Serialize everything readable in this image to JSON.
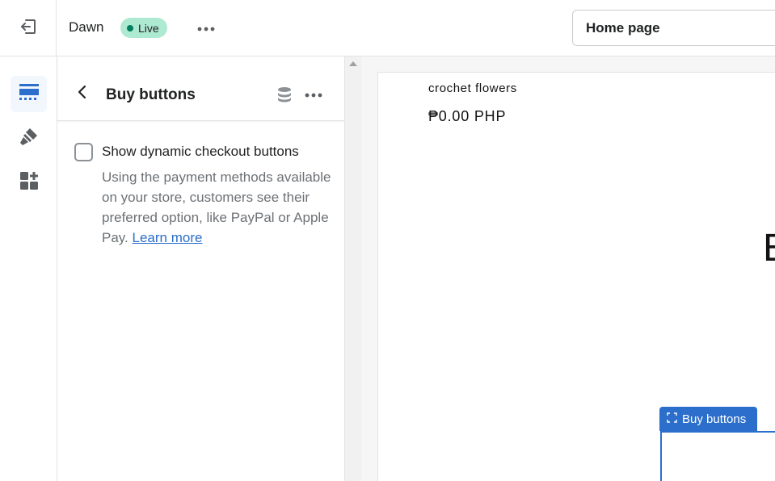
{
  "topbar": {
    "exit_icon": "exit-icon",
    "theme_name": "Dawn",
    "status_badge": "Live",
    "status_color": "#007f5f",
    "badge_bg": "#aee9d1",
    "more_icon": "more-horizontal-icon",
    "page_selector": "Home page"
  },
  "rail": {
    "items": [
      {
        "icon": "sections-icon",
        "active": true
      },
      {
        "icon": "theme-settings-brush-icon",
        "active": false
      },
      {
        "icon": "app-blocks-icon",
        "active": false
      }
    ]
  },
  "panel": {
    "title": "Buy buttons",
    "back_icon": "chevron-left-icon",
    "dynamic_source_icon": "database-icon",
    "more_icon": "more-horizontal-icon",
    "setting": {
      "label": "Show dynamic checkout buttons",
      "checked": false,
      "help_text": "Using the payment methods available on your store, customers see their preferred option, like PayPal or Apple Pay.",
      "help_link": "Learn more"
    }
  },
  "preview": {
    "product_name": "crochet flowers",
    "price": "₱0.00 PHP",
    "partial_text": "E",
    "selected_section_label": "Buy buttons",
    "accent": "#2c6ecb"
  }
}
